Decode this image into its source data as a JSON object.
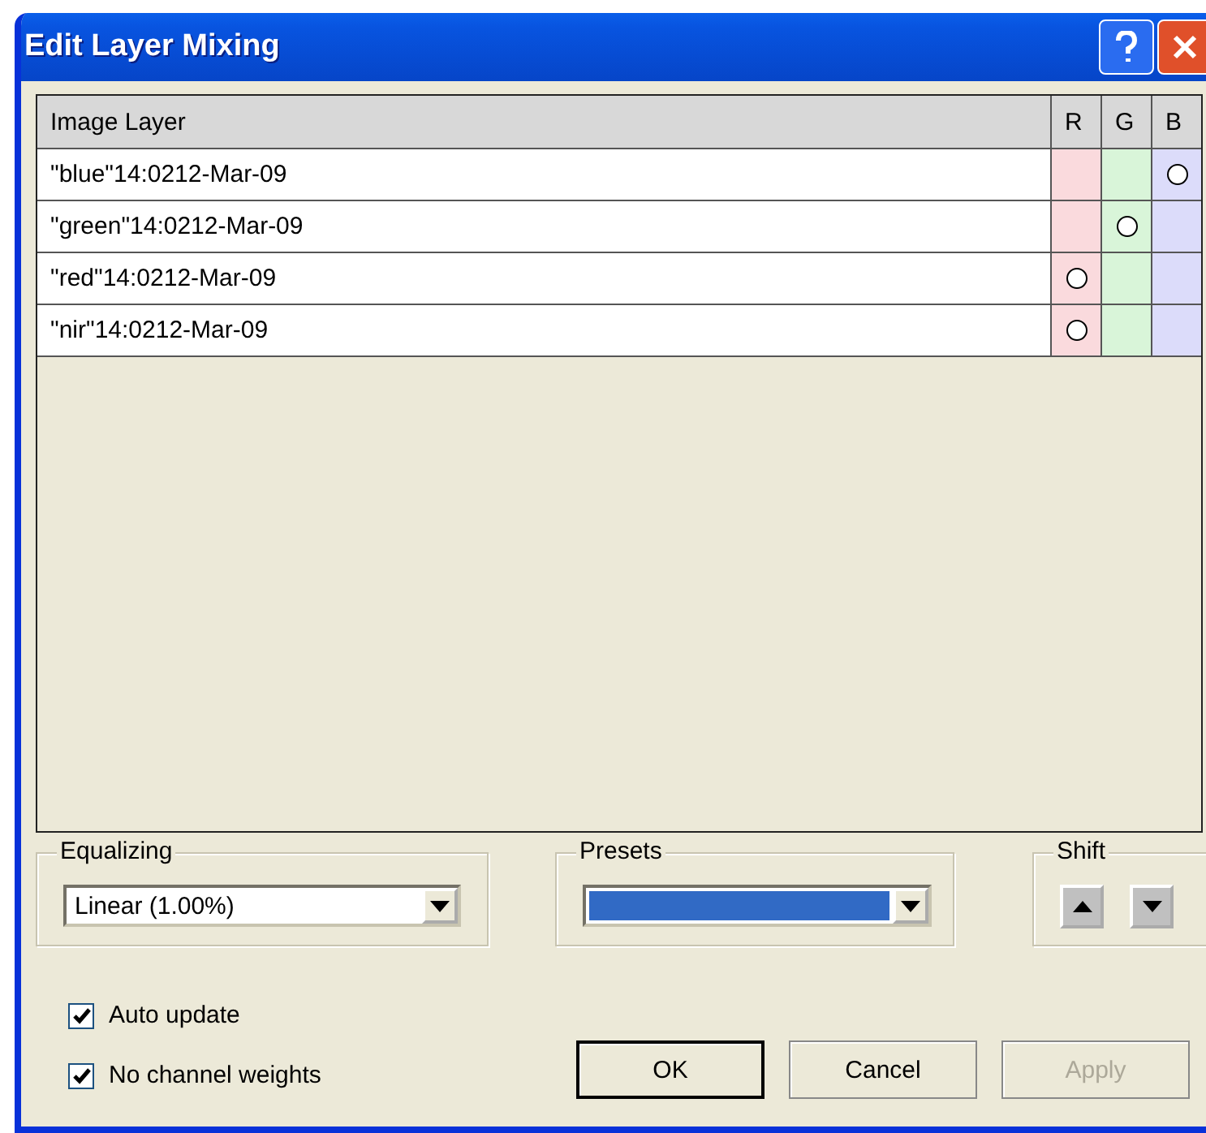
{
  "window": {
    "title": "Edit Layer Mixing"
  },
  "table": {
    "columns": [
      "Image Layer",
      "R",
      "G",
      "B"
    ],
    "rows": [
      {
        "name": "\"blue\"14:0212-Mar-09",
        "r": false,
        "g": false,
        "b": true
      },
      {
        "name": "\"green\"14:0212-Mar-09",
        "r": false,
        "g": true,
        "b": false
      },
      {
        "name": "\"red\"14:0212-Mar-09",
        "r": true,
        "g": false,
        "b": false
      },
      {
        "name": "\"nir\"14:0212-Mar-09",
        "r": true,
        "g": false,
        "b": false
      }
    ]
  },
  "equalizing": {
    "label": "Equalizing",
    "value": "Linear (1.00%)"
  },
  "presets": {
    "label": "Presets"
  },
  "shift": {
    "label": "Shift"
  },
  "checkboxes": [
    {
      "label": "Auto update",
      "checked": true
    },
    {
      "label": "No channel weights",
      "checked": true
    }
  ],
  "buttons": [
    {
      "label": "OK",
      "disabled": false,
      "default": true
    },
    {
      "label": "Cancel",
      "disabled": false,
      "default": false
    },
    {
      "label": "Apply",
      "disabled": true,
      "default": false
    }
  ]
}
